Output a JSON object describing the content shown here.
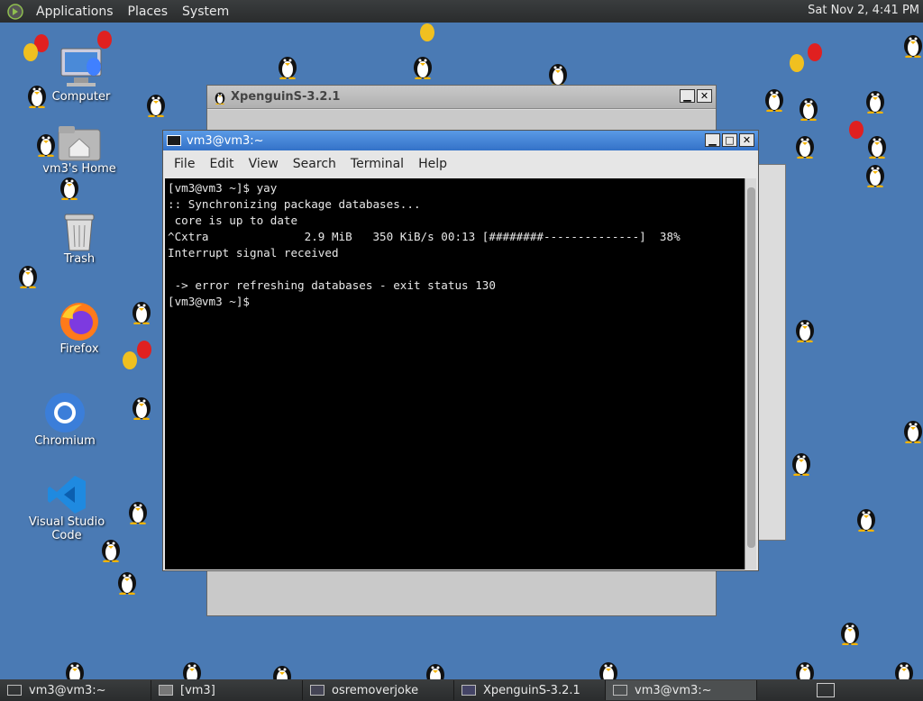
{
  "top_panel": {
    "menus": [
      "Applications",
      "Places",
      "System"
    ],
    "clock": "Sat Nov 2,  4:41 PM"
  },
  "desktop_icons": [
    {
      "label": "Computer",
      "icon": "computer-icon"
    },
    {
      "label": "vm3's Home",
      "icon": "home-folder-icon"
    },
    {
      "label": "Trash",
      "icon": "trash-icon"
    },
    {
      "label": "Firefox",
      "icon": "firefox-icon"
    },
    {
      "label": "Chromium",
      "icon": "chromium-icon"
    },
    {
      "label": "Visual Studio Code",
      "icon": "vscode-icon"
    }
  ],
  "xpenguins_window": {
    "title": "XpenguinS-3.2.1"
  },
  "terminal": {
    "title": "vm3@vm3:~",
    "menu": [
      "File",
      "Edit",
      "View",
      "Search",
      "Terminal",
      "Help"
    ],
    "lines": [
      "[vm3@vm3 ~]$ yay",
      ":: Synchronizing package databases...",
      " core is up to date",
      "^Cxtra              2.9 MiB   350 KiB/s 00:13 [########--------------]  38%",
      "Interrupt signal received",
      "",
      " -> error refreshing databases - exit status 130",
      "[vm3@vm3 ~]$ "
    ]
  },
  "taskbar": {
    "tasks": [
      {
        "label": "vm3@vm3:~",
        "icon": "terminal-icon"
      },
      {
        "label": "[vm3]",
        "icon": "folder-icon"
      },
      {
        "label": "osremoverjoke",
        "icon": "document-icon"
      },
      {
        "label": "XpenguinS-3.2.1",
        "icon": "window-icon"
      },
      {
        "label": "vm3@vm3:~",
        "icon": "terminal-icon"
      }
    ]
  }
}
